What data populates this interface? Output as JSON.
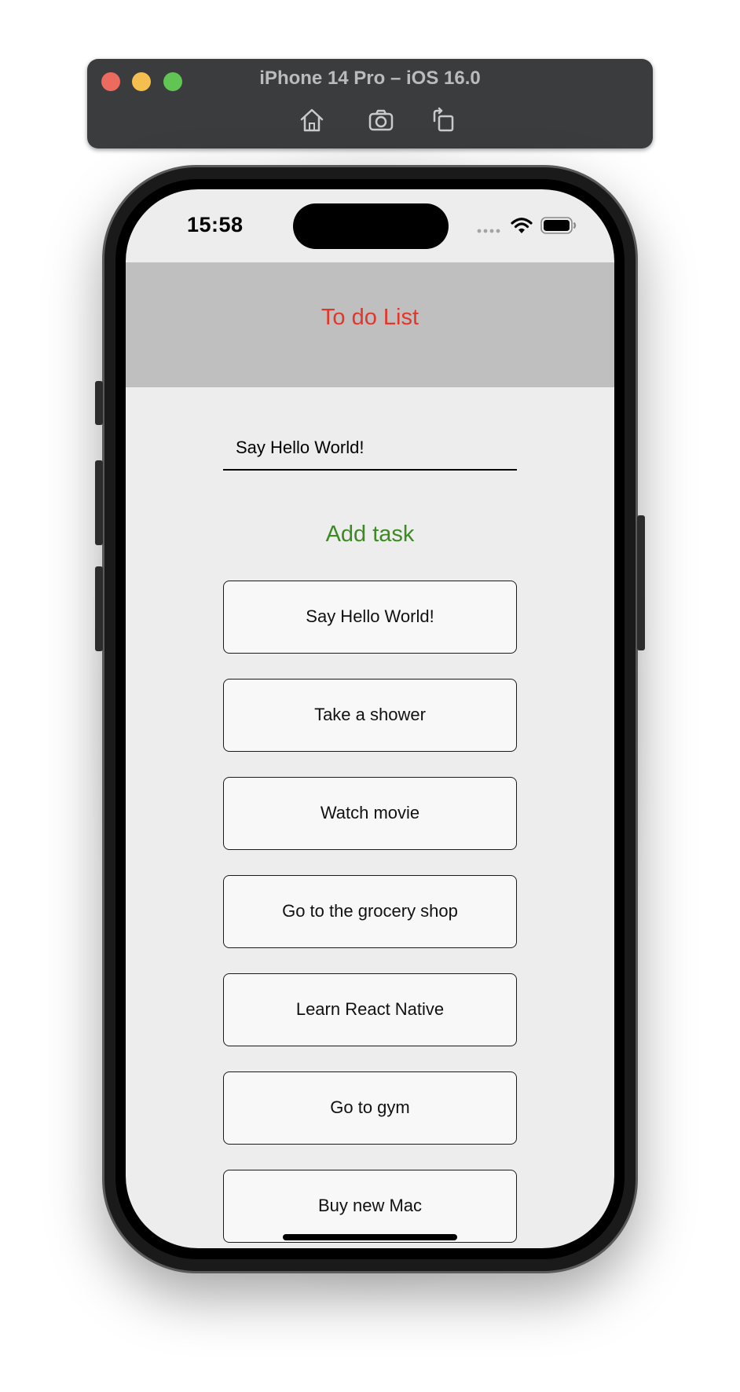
{
  "simulator": {
    "title": "iPhone 14 Pro – iOS 16.0",
    "tools": [
      {
        "icon": "home-icon"
      },
      {
        "icon": "camera-icon"
      },
      {
        "icon": "rotate-icon"
      }
    ],
    "colors": {
      "bar": "#3a3c3e",
      "close": "#ed6a5e",
      "minimize": "#f5bf4f",
      "zoom": "#61c554"
    }
  },
  "status_bar": {
    "time": "15:58",
    "icons": [
      "signal-dots-icon",
      "wifi-icon",
      "battery-icon"
    ]
  },
  "app": {
    "header_title": "To do List",
    "input": {
      "value": "Say Hello World!",
      "placeholder": ""
    },
    "add_button_label": "Add task",
    "tasks": [
      "Say Hello World!",
      "Take a shower",
      "Watch movie",
      "Go to the grocery shop",
      "Learn React Native",
      "Go to gym",
      "Buy new Mac"
    ],
    "colors": {
      "header_bg": "#bfbfbf",
      "title": "#e3352a",
      "add_button": "#3c8a22",
      "screen_bg": "#ededed",
      "task_bg": "#f8f8f8"
    }
  }
}
